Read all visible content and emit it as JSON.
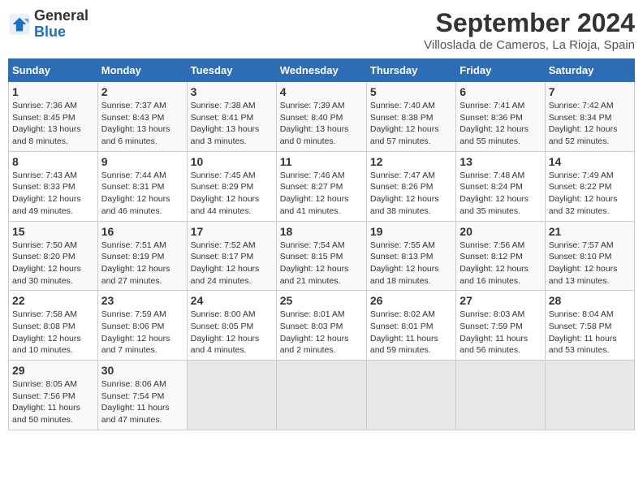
{
  "logo": {
    "line1": "General",
    "line2": "Blue"
  },
  "title": "September 2024",
  "location": "Villoslada de Cameros, La Rioja, Spain",
  "weekdays": [
    "Sunday",
    "Monday",
    "Tuesday",
    "Wednesday",
    "Thursday",
    "Friday",
    "Saturday"
  ],
  "weeks": [
    [
      {
        "day": "1",
        "info": "Sunrise: 7:36 AM\nSunset: 8:45 PM\nDaylight: 13 hours\nand 8 minutes."
      },
      {
        "day": "2",
        "info": "Sunrise: 7:37 AM\nSunset: 8:43 PM\nDaylight: 13 hours\nand 6 minutes."
      },
      {
        "day": "3",
        "info": "Sunrise: 7:38 AM\nSunset: 8:41 PM\nDaylight: 13 hours\nand 3 minutes."
      },
      {
        "day": "4",
        "info": "Sunrise: 7:39 AM\nSunset: 8:40 PM\nDaylight: 13 hours\nand 0 minutes."
      },
      {
        "day": "5",
        "info": "Sunrise: 7:40 AM\nSunset: 8:38 PM\nDaylight: 12 hours\nand 57 minutes."
      },
      {
        "day": "6",
        "info": "Sunrise: 7:41 AM\nSunset: 8:36 PM\nDaylight: 12 hours\nand 55 minutes."
      },
      {
        "day": "7",
        "info": "Sunrise: 7:42 AM\nSunset: 8:34 PM\nDaylight: 12 hours\nand 52 minutes."
      }
    ],
    [
      {
        "day": "8",
        "info": "Sunrise: 7:43 AM\nSunset: 8:33 PM\nDaylight: 12 hours\nand 49 minutes."
      },
      {
        "day": "9",
        "info": "Sunrise: 7:44 AM\nSunset: 8:31 PM\nDaylight: 12 hours\nand 46 minutes."
      },
      {
        "day": "10",
        "info": "Sunrise: 7:45 AM\nSunset: 8:29 PM\nDaylight: 12 hours\nand 44 minutes."
      },
      {
        "day": "11",
        "info": "Sunrise: 7:46 AM\nSunset: 8:27 PM\nDaylight: 12 hours\nand 41 minutes."
      },
      {
        "day": "12",
        "info": "Sunrise: 7:47 AM\nSunset: 8:26 PM\nDaylight: 12 hours\nand 38 minutes."
      },
      {
        "day": "13",
        "info": "Sunrise: 7:48 AM\nSunset: 8:24 PM\nDaylight: 12 hours\nand 35 minutes."
      },
      {
        "day": "14",
        "info": "Sunrise: 7:49 AM\nSunset: 8:22 PM\nDaylight: 12 hours\nand 32 minutes."
      }
    ],
    [
      {
        "day": "15",
        "info": "Sunrise: 7:50 AM\nSunset: 8:20 PM\nDaylight: 12 hours\nand 30 minutes."
      },
      {
        "day": "16",
        "info": "Sunrise: 7:51 AM\nSunset: 8:19 PM\nDaylight: 12 hours\nand 27 minutes."
      },
      {
        "day": "17",
        "info": "Sunrise: 7:52 AM\nSunset: 8:17 PM\nDaylight: 12 hours\nand 24 minutes."
      },
      {
        "day": "18",
        "info": "Sunrise: 7:54 AM\nSunset: 8:15 PM\nDaylight: 12 hours\nand 21 minutes."
      },
      {
        "day": "19",
        "info": "Sunrise: 7:55 AM\nSunset: 8:13 PM\nDaylight: 12 hours\nand 18 minutes."
      },
      {
        "day": "20",
        "info": "Sunrise: 7:56 AM\nSunset: 8:12 PM\nDaylight: 12 hours\nand 16 minutes."
      },
      {
        "day": "21",
        "info": "Sunrise: 7:57 AM\nSunset: 8:10 PM\nDaylight: 12 hours\nand 13 minutes."
      }
    ],
    [
      {
        "day": "22",
        "info": "Sunrise: 7:58 AM\nSunset: 8:08 PM\nDaylight: 12 hours\nand 10 minutes."
      },
      {
        "day": "23",
        "info": "Sunrise: 7:59 AM\nSunset: 8:06 PM\nDaylight: 12 hours\nand 7 minutes."
      },
      {
        "day": "24",
        "info": "Sunrise: 8:00 AM\nSunset: 8:05 PM\nDaylight: 12 hours\nand 4 minutes."
      },
      {
        "day": "25",
        "info": "Sunrise: 8:01 AM\nSunset: 8:03 PM\nDaylight: 12 hours\nand 2 minutes."
      },
      {
        "day": "26",
        "info": "Sunrise: 8:02 AM\nSunset: 8:01 PM\nDaylight: 11 hours\nand 59 minutes."
      },
      {
        "day": "27",
        "info": "Sunrise: 8:03 AM\nSunset: 7:59 PM\nDaylight: 11 hours\nand 56 minutes."
      },
      {
        "day": "28",
        "info": "Sunrise: 8:04 AM\nSunset: 7:58 PM\nDaylight: 11 hours\nand 53 minutes."
      }
    ],
    [
      {
        "day": "29",
        "info": "Sunrise: 8:05 AM\nSunset: 7:56 PM\nDaylight: 11 hours\nand 50 minutes."
      },
      {
        "day": "30",
        "info": "Sunrise: 8:06 AM\nSunset: 7:54 PM\nDaylight: 11 hours\nand 47 minutes."
      },
      {
        "day": "",
        "info": ""
      },
      {
        "day": "",
        "info": ""
      },
      {
        "day": "",
        "info": ""
      },
      {
        "day": "",
        "info": ""
      },
      {
        "day": "",
        "info": ""
      }
    ]
  ]
}
